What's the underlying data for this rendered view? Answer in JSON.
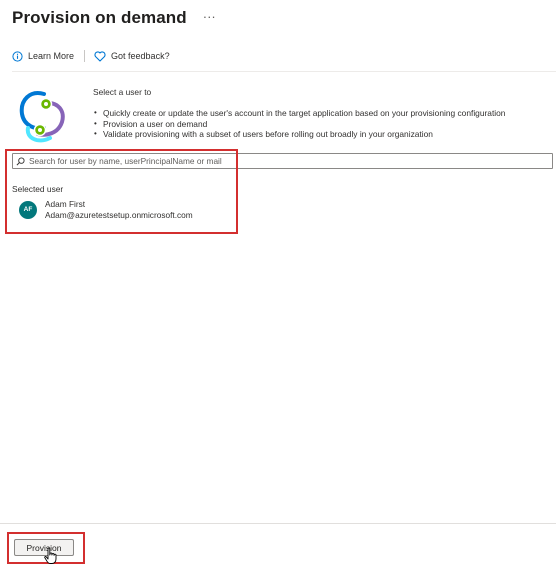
{
  "header": {
    "title": "Provision on demand",
    "more_label": "···"
  },
  "toolbar": {
    "learn_more": {
      "label": "Learn More",
      "icon": "info-icon"
    },
    "feedback": {
      "label": "Got feedback?",
      "icon": "heart-icon"
    }
  },
  "intro": {
    "heading": "Select a user to",
    "bullets": [
      "Quickly create or update the user's account in the target application based on your provisioning configuration",
      "Provision a user on demand",
      "Validate provisioning with a subset of users before rolling out broadly in your organization"
    ]
  },
  "search": {
    "placeholder": "Search for user by name, userPrincipalName or mail",
    "value": ""
  },
  "selected_user": {
    "label": "Selected user",
    "initials": "AF",
    "name": "Adam First",
    "email": "Adam@azuretestsetup.onmicrosoft.com",
    "avatar_color": "#03787c"
  },
  "footer": {
    "provision_label": "Provision"
  },
  "colors": {
    "highlight": "#d32f2f",
    "accent": "#0078d4"
  }
}
